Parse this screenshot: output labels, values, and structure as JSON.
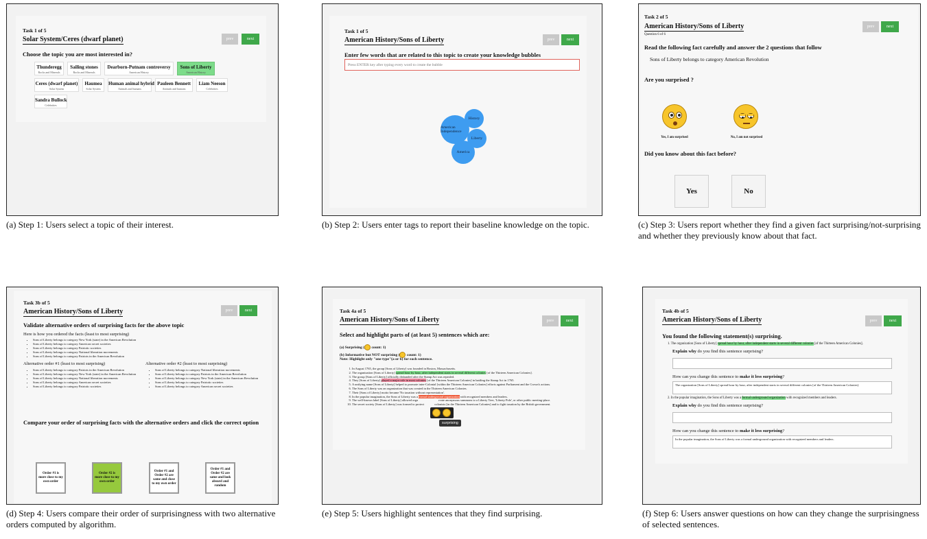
{
  "buttons": {
    "prev": "prev",
    "next": "next"
  },
  "panel_a": {
    "task": "Task 1 of 5",
    "title": "Solar System/Ceres (dwarf planet)",
    "question": "Choose the topic you are most interested in?",
    "topics": [
      {
        "name": "Thunderegg",
        "sub": "Rocks and Minerals"
      },
      {
        "name": "Sailing stones",
        "sub": "Rocks and Minerals"
      },
      {
        "name": "Dearborn-Putnam controversy",
        "sub": "American History"
      },
      {
        "name": "Sons of Liberty",
        "sub": "American History"
      },
      {
        "name": "Ceres (dwarf planet)",
        "sub": "Solar System"
      },
      {
        "name": "Haumea",
        "sub": "Solar System"
      },
      {
        "name": "Human animal hybrid",
        "sub": "Animals and humans"
      },
      {
        "name": "Pauleen Bennett",
        "sub": "Animals and humans"
      },
      {
        "name": "Liam Neeson",
        "sub": "Celebrities"
      },
      {
        "name": "Sandra Bullock",
        "sub": "Celebrities"
      }
    ],
    "caption": "(a) Step 1: Users select a topic of their interest."
  },
  "panel_b": {
    "task": "Task 1 of 5",
    "title": "American History/Sons of Liberty",
    "question": "Enter few words that are related to this topic to create your knowledge bubbles",
    "placeholder": "Press ENTER key after typing every word to create the bubble",
    "bubbles": [
      "History",
      "American Independence",
      "Liberty",
      "America"
    ],
    "caption": "(b) Step 2: Users enter tags to report their baseline knowledge on the topic."
  },
  "panel_c": {
    "task": "Task 2 of 5",
    "title": "American History/Sons of Liberty",
    "subq": "Question 6 of 6",
    "instr": "Read the following fact carefully and answer the 2 questions that follow",
    "fact": "Sons of Liberty belongs to category American Revolution",
    "q1": "Are you surprised ?",
    "yes_surprised": "Yes, I am surprised",
    "not_surprised": "No, I am not surprised",
    "q2": "Did you know about this fact before?",
    "yes": "Yes",
    "no": "No",
    "caption": "(c) Step 3: Users report whether they find a given fact surprising/not-surprising and whether they previously know about that fact."
  },
  "panel_d": {
    "task": "Task 3b of 5",
    "title": "American History/Sons of Liberty",
    "heading": "Validate alternative orders of surprising facts for the above topic",
    "own_label": "Here is how you ordered the facts (least to most surprising)",
    "own": [
      "Sons of Liberty belongs to category New York (state) in the American Revolution",
      "Sons of Liberty belongs to category American secret societies",
      "Sons of Liberty belongs to category Patriotic societies",
      "Sons of Liberty belongs to category National liberation movements",
      "Sons of Liberty belongs to category Patriots in the American Revolution"
    ],
    "alt1_label": "Alternative order #1 (least to most surprising)",
    "alt1": [
      "Sons of Liberty belongs to category Patriots in the American Revolution",
      "Sons of Liberty belongs to category New York (state) in the American Revolution",
      "Sons of Liberty belongs to category National liberation movements",
      "Sons of Liberty belongs to category American secret societies",
      "Sons of Liberty belongs to category Patriotic societies"
    ],
    "alt2_label": "Alternative order #2 (least to most surprising)",
    "alt2": [
      "Sons of Liberty belongs to category National liberation movements",
      "Sons of Liberty belongs to category Patriots in the American Revolution",
      "Sons of Liberty belongs to category New York (state) in the American Revolution",
      "Sons of Liberty belongs to category Patriotic societies",
      "Sons of Liberty belongs to category American secret societies"
    ],
    "compare": "Compare your order of surprising facts with the alternative orders and click the correct option",
    "options": [
      "Order #1 is more close to my own order",
      "Order #2 is more close to my own order",
      "Order #1 and Order #2 are same and close to my own order",
      "Order #1 and Order #2 are same and look absurd and random"
    ],
    "caption": "(d) Step 4: Users compare their order of surprisingness with two alternative orders computed by algorithm."
  },
  "panel_e": {
    "task": "Task 4a of 5",
    "title": "American History/Sons of Liberty",
    "heading": "Select and highlight parts of (at least 5) sentences which are:",
    "a_pre": "(a) Surprising (",
    "a_post": " count: 1)",
    "b_pre": "(b) Informative but NOT surprising (",
    "b_post": " count: 1)",
    "note": "Note: Highlight only \"one type\"(a or b) for each sentence.",
    "s1": "In August 1765, the group [Sons of Liberty] was founded in Boston, Massachusetts.",
    "s2_pre": "The organization [Sons of Liberty] ",
    "s2_hl": "spread hour by hour, after independent starts in several different colonies",
    "s2_post": " [of the Thirteen American Colonies].",
    "s3": "The group [Sons of Liberty] officially disbanded after the Stamp Act was repealed.",
    "s4_pre": "They [Sons of Liberty] ",
    "s4_hl": "played a major role in most colonies",
    "s4_post": " [of the Thirteen American Colonies] in battling the Stamp Act in 1765.",
    "s5": "A unifying name [Sons of Liberty] helped to promote inter-Colonial [within the Thirteen American Colonies] efforts against Parliament and the Crown's actions.",
    "s6": "The Sons of Liberty was an organization that was created in the Thirteen American Colonies.",
    "s7": "Their [Sons of Liberty] motto became 'No taxation without representation'.",
    "s8_pre": "In the popular imagination, the Sons of Liberty was a ",
    "s8_hl": "formal underground organization",
    "s8_post": " with recognized members and leaders.",
    "s9_pre": "The well-known label [Sons of Liberty] allowed orga",
    "s9_post": "rvate anonymous summons to a Liberty Tree, 'Liberty Pole', or other public meeting-place.",
    "s10_pre": "The secret society [Sons of Liberty] was formed to protect",
    "s10_post": " colonists [in the Thirteen American Colonies] and to fight taxation by the British government.",
    "tooltip": "surprising",
    "caption": "(e) Step 5: Users highlight sentences that they find surprising."
  },
  "panel_f": {
    "task": "Task 4b of 5",
    "title": "American History/Sons of Liberty",
    "heading": "You found the following statement(s) surprising.",
    "item1_pre": "The organization [Sons of Liberty] ",
    "item1_hl": "spread hour by hour, after independent starts in several different colonies",
    "item1_post": " [of the Thirteen American Colonies].",
    "explain_pre": "Explain ",
    "explain_bold": "why",
    "explain_post": " do you find this sentence surprising?",
    "change_pre": "How can you change this sentence to ",
    "change_bold": "make it less surprising",
    "change_post": "?",
    "box1": "The organization [Sons of Liberty] spread hour by hour, after independent starts in several different colonies [of the Thirteen American Colonies].",
    "item2_pre": "In the popular imagination, the Sons of Liberty was a ",
    "item2_hl": "formal underground organization",
    "item2_post": " with recognized members and leaders.",
    "box2": "In the popular imagination, the Sons of Liberty was a formal underground organization with recognized members and leaders.",
    "caption": "(f) Step 6: Users answer questions on how can they change the surprisingness of selected sentences."
  }
}
